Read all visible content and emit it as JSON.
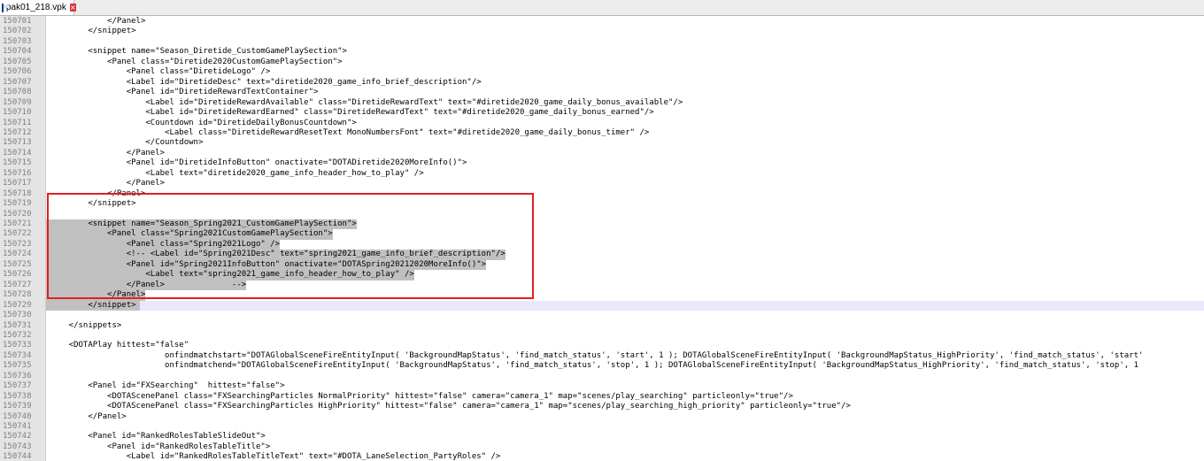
{
  "tab": {
    "title": "pak01_218.vpk",
    "close": "×"
  },
  "colors": {
    "selection": "#c0c0c0",
    "caret_line": "#e8e8ff",
    "annotation": "#e02020"
  },
  "lines": [
    {
      "n": "150701",
      "t": "            </Panel>"
    },
    {
      "n": "150702",
      "t": "        </snippet>"
    },
    {
      "n": "150703",
      "t": ""
    },
    {
      "n": "150704",
      "t": "        <snippet name=\"Season_Diretide_CustomGamePlaySection\">"
    },
    {
      "n": "150705",
      "t": "            <Panel class=\"Diretide2020CustomGamePlaySection\">"
    },
    {
      "n": "150706",
      "t": "                <Panel class=\"DiretideLogo\" />"
    },
    {
      "n": "150707",
      "t": "                <Label id=\"DiretideDesc\" text=\"diretide2020_game_info_brief_description\"/>"
    },
    {
      "n": "150708",
      "t": "                <Panel id=\"DiretideRewardTextContainer\">"
    },
    {
      "n": "150709",
      "t": "                    <Label id=\"DiretideRewardAvailable\" class=\"DiretideRewardText\" text=\"#diretide2020_game_daily_bonus_available\"/>"
    },
    {
      "n": "150710",
      "t": "                    <Label id=\"DiretideRewardEarned\" class=\"DiretideRewardText\" text=\"#diretide2020_game_daily_bonus_earned\"/>"
    },
    {
      "n": "150711",
      "t": "                    <Countdown id=\"DiretideDailyBonusCountdown\">"
    },
    {
      "n": "150712",
      "t": "                        <Label class=\"DiretideRewardResetText MonoNumbersFont\" text=\"#diretide2020_game_daily_bonus_timer\" />"
    },
    {
      "n": "150713",
      "t": "                    </Countdown>"
    },
    {
      "n": "150714",
      "t": "                </Panel>"
    },
    {
      "n": "150715",
      "t": "                <Panel id=\"DiretideInfoButton\" onactivate=\"DOTADiretide2020MoreInfo()\">"
    },
    {
      "n": "150716",
      "t": "                    <Label text=\"diretide2020_game_info_header_how_to_play\" />"
    },
    {
      "n": "150717",
      "t": "                </Panel>"
    },
    {
      "n": "150718",
      "t": "            </Panel>"
    },
    {
      "n": "150719",
      "t": "        </snippet>"
    },
    {
      "n": "150720",
      "t": ""
    },
    {
      "n": "150721",
      "t": "        <snippet name=\"Season_Spring2021_CustomGamePlaySection\">",
      "sel": true
    },
    {
      "n": "150722",
      "t": "            <Panel class=\"Spring2021CustomGamePlaySection\">",
      "sel": true
    },
    {
      "n": "150723",
      "t": "                <Panel class=\"Spring2021Logo\" />",
      "sel": true
    },
    {
      "n": "150724",
      "t": "                <!-- <Label id=\"Spring2021Desc\" text=\"spring2021_game_info_brief_description\"/>",
      "sel": true
    },
    {
      "n": "150725",
      "t": "                <Panel id=\"Spring2021InfoButton\" onactivate=\"DOTASpring20212020MoreInfo()\">",
      "sel": true
    },
    {
      "n": "150726",
      "t": "                    <Label text=\"spring2021_game_info_header_how_to_play\" />",
      "sel": true
    },
    {
      "n": "150727",
      "t": "                </Panel>              -->",
      "sel": true
    },
    {
      "n": "150728",
      "t": "            </Panel>",
      "sel": true
    },
    {
      "n": "150729",
      "t": "        </snippet>",
      "sel": true
    },
    {
      "n": "150730",
      "t": ""
    },
    {
      "n": "150731",
      "t": "    </snippets>"
    },
    {
      "n": "150732",
      "t": ""
    },
    {
      "n": "150733",
      "t": "    <DOTAPlay hittest=\"false\""
    },
    {
      "n": "150734",
      "t": "                        onfindmatchstart=\"DOTAGlobalSceneFireEntityInput( 'BackgroundMapStatus', 'find_match_status', 'start', 1 ); DOTAGlobalSceneFireEntityInput( 'BackgroundMapStatus_HighPriority', 'find_match_status', 'start'"
    },
    {
      "n": "150735",
      "t": "                        onfindmatchend=\"DOTAGlobalSceneFireEntityInput( 'BackgroundMapStatus', 'find_match_status', 'stop', 1 ); DOTAGlobalSceneFireEntityInput( 'BackgroundMapStatus_HighPriority', 'find_match_status', 'stop', 1"
    },
    {
      "n": "150736",
      "t": ""
    },
    {
      "n": "150737",
      "t": "        <Panel id=\"FXSearching\"  hittest=\"false\">"
    },
    {
      "n": "150738",
      "t": "            <DOTAScenePanel class=\"FXSearchingParticles NormalPriority\" hittest=\"false\" camera=\"camera_1\" map=\"scenes/play_searching\" particleonly=\"true\"/>"
    },
    {
      "n": "150739",
      "t": "            <DOTAScenePanel class=\"FXSearchingParticles HighPriority\" hittest=\"false\" camera=\"camera_1\" map=\"scenes/play_searching_high_priority\" particleonly=\"true\"/>"
    },
    {
      "n": "150740",
      "t": "        </Panel>"
    },
    {
      "n": "150741",
      "t": ""
    },
    {
      "n": "150742",
      "t": "        <Panel id=\"RankedRolesTableSlideOut\">"
    },
    {
      "n": "150743",
      "t": "            <Panel id=\"RankedRolesTableTitle\">"
    },
    {
      "n": "150744",
      "t": "                <Label id=\"RankedRolesTableTitleText\" text=\"#DOTA_LaneSelection_PartyRoles\" />"
    }
  ]
}
